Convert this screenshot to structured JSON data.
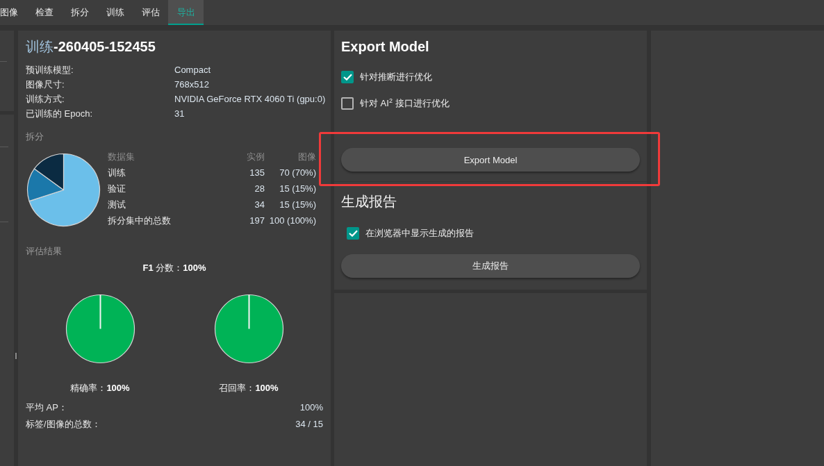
{
  "tabs": [
    {
      "label": "图像",
      "selected": false
    },
    {
      "label": "检查",
      "selected": false
    },
    {
      "label": "拆分",
      "selected": false
    },
    {
      "label": "训练",
      "selected": false
    },
    {
      "label": "评估",
      "selected": false
    },
    {
      "label": "导出",
      "selected": true
    }
  ],
  "training_panel": {
    "title": "训练**-260405-152455**",
    "info": [
      {
        "label": "预训练模型:",
        "value": "Compact"
      },
      {
        "label": "图像尺寸:",
        "value": "768x512"
      },
      {
        "label": "训练方式:",
        "value": "NVIDIA GeForce RTX 4060 Ti (gpu:0)"
      },
      {
        "label": "已训练的 Epoch:",
        "value": "31"
      }
    ],
    "split": {
      "heading": "拆分",
      "chart_data": {
        "type": "pie",
        "values": [
          70,
          15,
          15
        ]
      },
      "table": {
        "columns": [
          "数据集",
          "实例",
          "图像"
        ],
        "rows": [
          [
            "训练",
            "135",
            "70 (70%)"
          ],
          [
            "验证",
            "28",
            "15 (15%)"
          ],
          [
            "测试",
            "34",
            "15 (15%)"
          ],
          [
            "拆分集中的总数",
            "197",
            "100 (100%)"
          ]
        ]
      }
    },
    "evaluation": {
      "heading": "评估结果",
      "f1": "**F1** 分数：**100%**",
      "charts": [
        {
          "caption": "精确率：**100%**",
          "chart_data": {
            "type": "pie",
            "values": [
              100
            ]
          }
        },
        {
          "caption": "召回率：**100%**",
          "chart_data": {
            "type": "pie",
            "values": [
              100
            ]
          }
        }
      ],
      "metrics": [
        {
          "label": "平均 AP：",
          "value": "100%"
        },
        {
          "label": "标签/图像的总数：",
          "value": "34 / 15"
        }
      ]
    }
  },
  "export_panel": {
    "title": "Export Model",
    "options": [
      {
        "label": "针对推断进行优化",
        "checked": true
      },
      {
        "label": "针对 AI$^{2}$ 接口进行优化",
        "checked": false
      }
    ],
    "button": "Export Model"
  },
  "report_panel": {
    "title": "生成报告",
    "options": [
      {
        "label": "在浏览器中显示生成的报告",
        "checked": true
      }
    ],
    "button": "生成报告"
  }
}
